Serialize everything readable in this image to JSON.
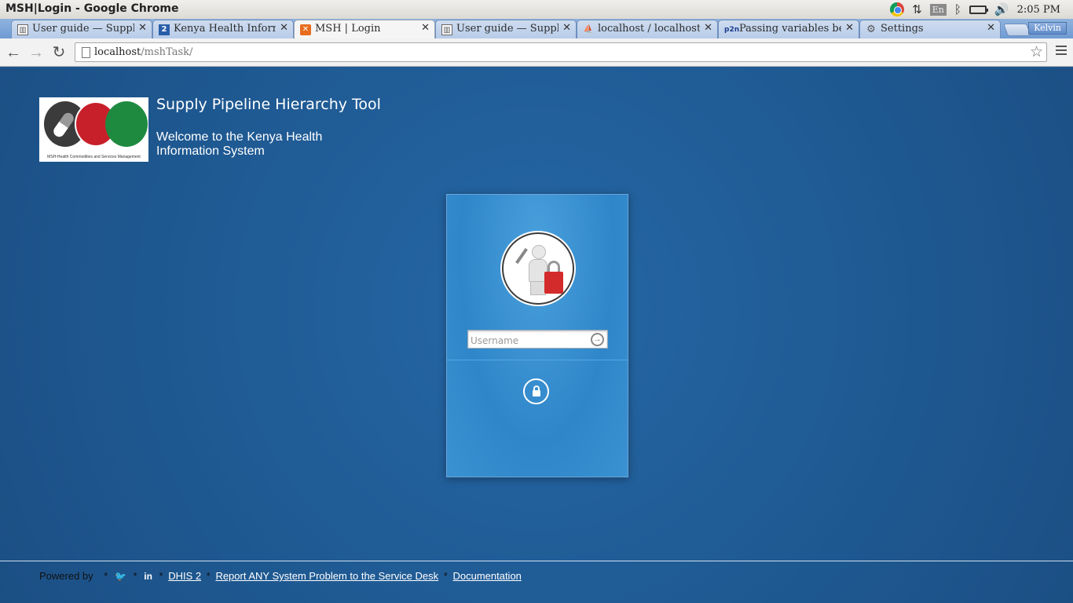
{
  "window": {
    "title": "MSH|Login - Google Chrome"
  },
  "tray": {
    "language": "En",
    "clock": "2:05 PM"
  },
  "tabs": [
    {
      "label": "User guide — Supply",
      "icon": "doc-icon"
    },
    {
      "label": "Kenya Health Informa",
      "icon": "dhis2-icon",
      "icon_text": "2"
    },
    {
      "label": "MSH | Login",
      "icon": "xampp-icon",
      "active": true
    },
    {
      "label": "User guide — Supply",
      "icon": "doc-icon"
    },
    {
      "label": "localhost / localhost /",
      "icon": "phpmyadmin-icon"
    },
    {
      "label": "Passing variables betw",
      "icon": "p2n-icon",
      "icon_text": "p2n"
    },
    {
      "label": "Settings",
      "icon": "gear-icon"
    }
  ],
  "profile": {
    "name": "Kelvin"
  },
  "address_bar": {
    "host": "localhost",
    "path": "/mshTask/"
  },
  "header": {
    "logo_caption": "MSH-Health Commodities and Services Management",
    "app_title": "Supply Pipeline Hierarchy Tool",
    "welcome": "Welcome to the Kenya Health Information System"
  },
  "login": {
    "username_placeholder": "Username"
  },
  "footer": {
    "powered_by": "Powered by",
    "links": {
      "dhis2": "DHIS 2",
      "report": "Report ANY System Problem to the Service Desk",
      "documentation": "Documentation"
    }
  },
  "colors": {
    "page_bg": "#1f5a93",
    "card_bg": "#3b92d2",
    "brand_red": "#c8202a",
    "brand_green": "#1e8a3f"
  }
}
